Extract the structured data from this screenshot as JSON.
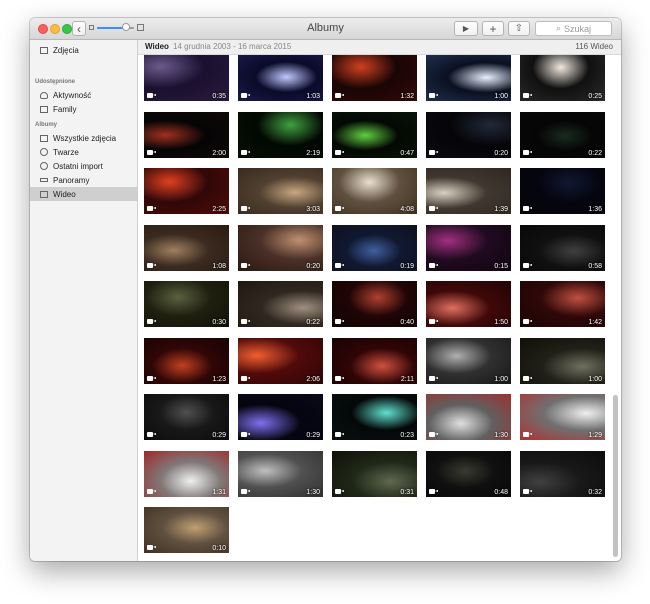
{
  "window": {
    "title": "Albumy",
    "search_placeholder": "Szukaj",
    "back_symbol": "‹",
    "play_symbol": "▶",
    "add_symbol": "+",
    "share_symbol": "⇧",
    "search_symbol": "⌕"
  },
  "zoom_slider": {
    "level": 0.78
  },
  "sidebar": {
    "top_item": "Zdjęcia",
    "shared_header": "Udostępnione",
    "shared": [
      "Aktywność",
      "Family"
    ],
    "albums_header": "Albumy",
    "albums": [
      "Wszystkie zdjęcia",
      "Twarze",
      "Ostatni import",
      "Panoramy",
      "Wideo"
    ],
    "selected": "Wideo"
  },
  "header": {
    "title": "Wideo",
    "date_range": "14 grudnia 2003 - 16 marca 2015",
    "count": "116 Wideo"
  },
  "videos": [
    {
      "duration": "0:35",
      "colors": [
        "#1a1030",
        "#6a5a8a",
        "#2a1a3a"
      ]
    },
    {
      "duration": "1:03",
      "colors": [
        "#0a0a2a",
        "#c0c8ff",
        "#1a1a4a"
      ]
    },
    {
      "duration": "1:32",
      "colors": [
        "#1a0505",
        "#d04020",
        "#300a08"
      ]
    },
    {
      "duration": "1:00",
      "colors": [
        "#0a1020",
        "#e8f0ff",
        "#203050"
      ]
    },
    {
      "duration": "0:25",
      "colors": [
        "#101010",
        "#f0e8e0",
        "#2a2a2a"
      ]
    },
    {
      "duration": "2:00",
      "colors": [
        "#050505",
        "#a03020",
        "#100808"
      ]
    },
    {
      "duration": "2:19",
      "colors": [
        "#020802",
        "#40a040",
        "#051005"
      ]
    },
    {
      "duration": "0:47",
      "colors": [
        "#030803",
        "#60d040",
        "#081508"
      ]
    },
    {
      "duration": "0:20",
      "colors": [
        "#050508",
        "#202838",
        "#0a0a10"
      ]
    },
    {
      "duration": "0:22",
      "colors": [
        "#050505",
        "#1a2a20",
        "#080808"
      ]
    },
    {
      "duration": "2:25",
      "colors": [
        "#300808",
        "#e04020",
        "#500a0a"
      ]
    },
    {
      "duration": "3:03",
      "colors": [
        "#504030",
        "#c8a880",
        "#3a2a20"
      ]
    },
    {
      "duration": "4:08",
      "colors": [
        "#605040",
        "#e8e0d0",
        "#403020"
      ]
    },
    {
      "duration": "1:39",
      "colors": [
        "#403830",
        "#d8d0c0",
        "#302820"
      ]
    },
    {
      "duration": "1:36",
      "colors": [
        "#050510",
        "#101830",
        "#050508"
      ]
    },
    {
      "duration": "1:08",
      "colors": [
        "#3a2a20",
        "#a08060",
        "#2a1a10"
      ]
    },
    {
      "duration": "0:20",
      "colors": [
        "#4a3028",
        "#c09070",
        "#2a1810"
      ]
    },
    {
      "duration": "0:19",
      "colors": [
        "#101830",
        "#4060a0",
        "#101020"
      ]
    },
    {
      "duration": "0:15",
      "colors": [
        "#200a20",
        "#a03080",
        "#100510"
      ]
    },
    {
      "duration": "0:58",
      "colors": [
        "#101010",
        "#404040",
        "#080808"
      ]
    },
    {
      "duration": "0:30",
      "colors": [
        "#202010",
        "#5a6040",
        "#101008"
      ]
    },
    {
      "duration": "0:22",
      "colors": [
        "#302820",
        "#a09080",
        "#201810"
      ]
    },
    {
      "duration": "0:40",
      "colors": [
        "#200505",
        "#b04030",
        "#100303"
      ]
    },
    {
      "duration": "1:50",
      "colors": [
        "#400808",
        "#e07060",
        "#200404"
      ]
    },
    {
      "duration": "1:42",
      "colors": [
        "#300808",
        "#c05040",
        "#180404"
      ]
    },
    {
      "duration": "1:23",
      "colors": [
        "#300606",
        "#c04020",
        "#180303"
      ]
    },
    {
      "duration": "2:06",
      "colors": [
        "#500a0a",
        "#f06030",
        "#300505"
      ]
    },
    {
      "duration": "2:11",
      "colors": [
        "#300505",
        "#d05040",
        "#180303"
      ]
    },
    {
      "duration": "1:00",
      "colors": [
        "#303030",
        "#b0b0b0",
        "#181818"
      ]
    },
    {
      "duration": "1:00",
      "colors": [
        "#202018",
        "#707060",
        "#101008"
      ]
    },
    {
      "duration": "0:29",
      "colors": [
        "#181818",
        "#505050",
        "#0c0c0c"
      ]
    },
    {
      "duration": "0:29",
      "colors": [
        "#050510",
        "#8070f0",
        "#080818"
      ]
    },
    {
      "duration": "0:23",
      "colors": [
        "#050808",
        "#60e0d0",
        "#081010"
      ]
    },
    {
      "duration": "1:30",
      "colors": [
        "#606060",
        "#e0e0e0",
        "#a03030"
      ]
    },
    {
      "duration": "1:29",
      "colors": [
        "#707070",
        "#f0f0f0",
        "#b03030"
      ]
    },
    {
      "duration": "1:31",
      "colors": [
        "#807878",
        "#f0f0f0",
        "#a02828"
      ]
    },
    {
      "duration": "1:30",
      "colors": [
        "#505050",
        "#c0c0c0",
        "#303030"
      ]
    },
    {
      "duration": "0:31",
      "colors": [
        "#202818",
        "#606850",
        "#101008"
      ]
    },
    {
      "duration": "0:48",
      "colors": [
        "#101010",
        "#3a3a30",
        "#080808"
      ]
    },
    {
      "duration": "0:32",
      "colors": [
        "#181818",
        "#404040",
        "#0c0c0c"
      ]
    },
    {
      "duration": "0:10",
      "colors": [
        "#605040",
        "#c0a070",
        "#403020"
      ]
    }
  ]
}
